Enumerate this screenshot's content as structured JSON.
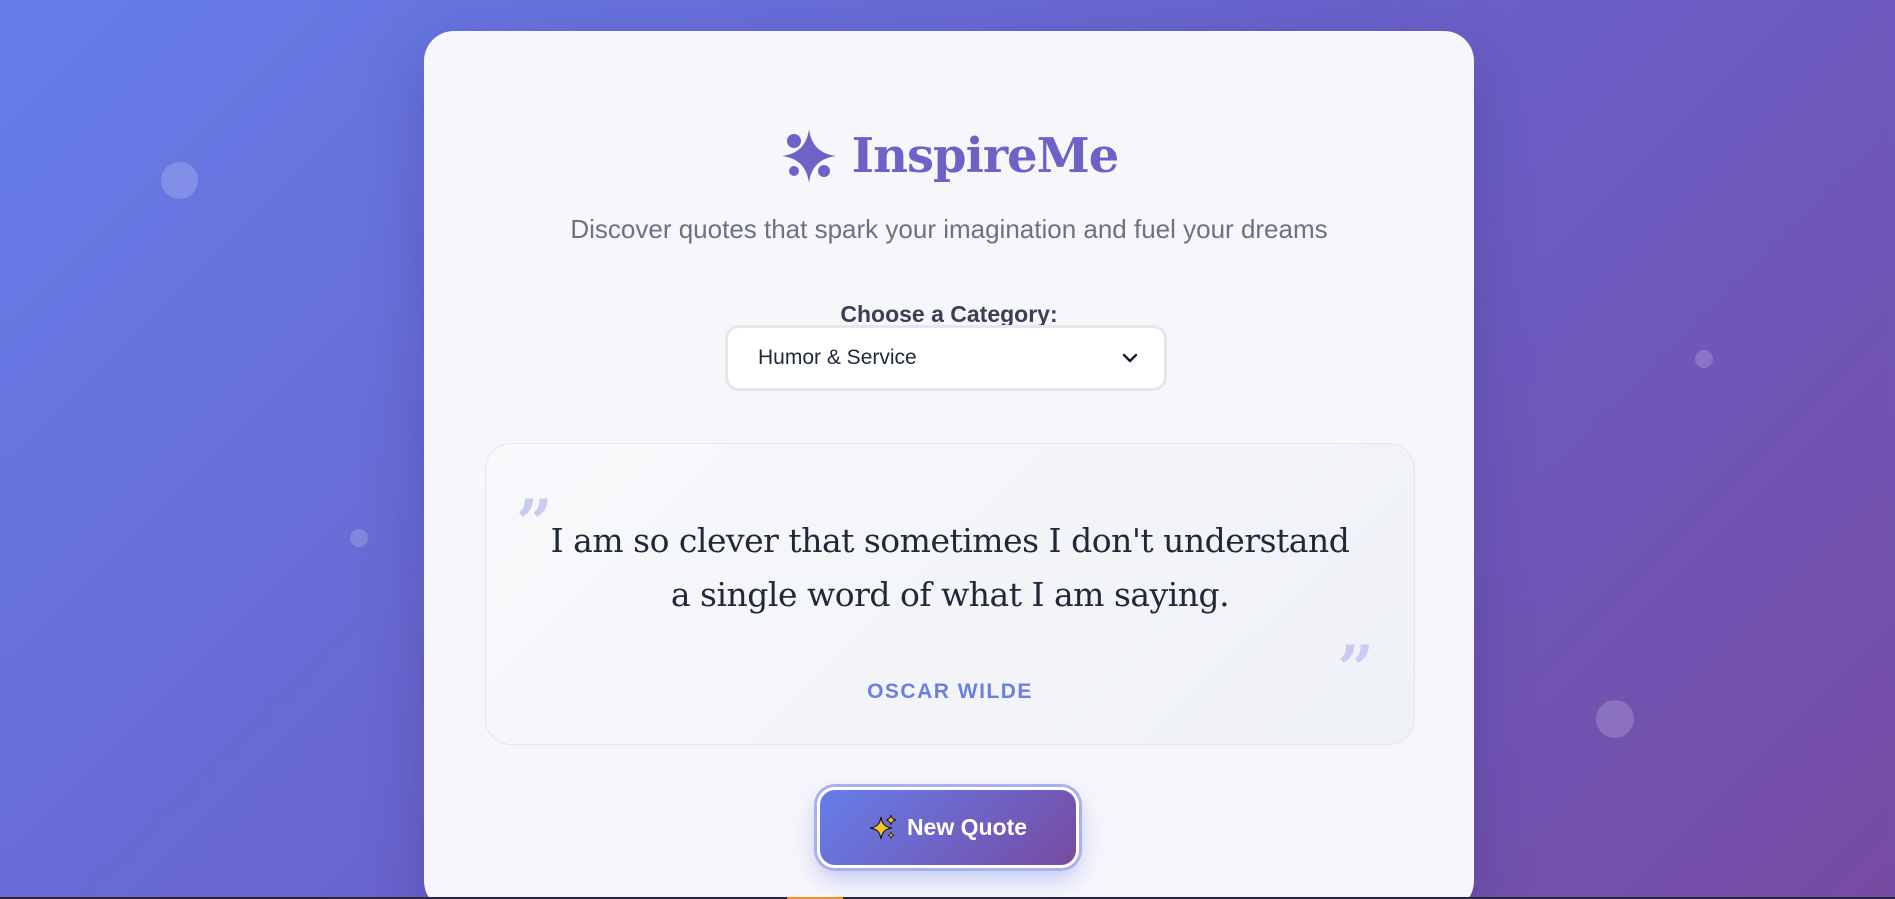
{
  "app": {
    "title": "InspireMe",
    "subtitle": "Discover quotes that spark your imagination and fuel your dreams"
  },
  "category": {
    "label": "Choose a Category:",
    "selected": "Humor & Service"
  },
  "quote": {
    "text": "I am so clever that sometimes I don't understand a single word of what I am saying.",
    "author": "OSCAR WILDE",
    "open_mark": "”",
    "close_mark": "”"
  },
  "actions": {
    "new_quote_label": "New Quote"
  },
  "icons": {
    "logo": "sparkle-logo-icon",
    "dropdown": "chevron-down-icon",
    "button": "sparkles-icon"
  },
  "colors": {
    "bg_start": "#667eea",
    "bg_end": "#764ba2",
    "title": "#6d63c6",
    "author": "#6b7fdc",
    "quote_mark": "#c7cdf2"
  }
}
